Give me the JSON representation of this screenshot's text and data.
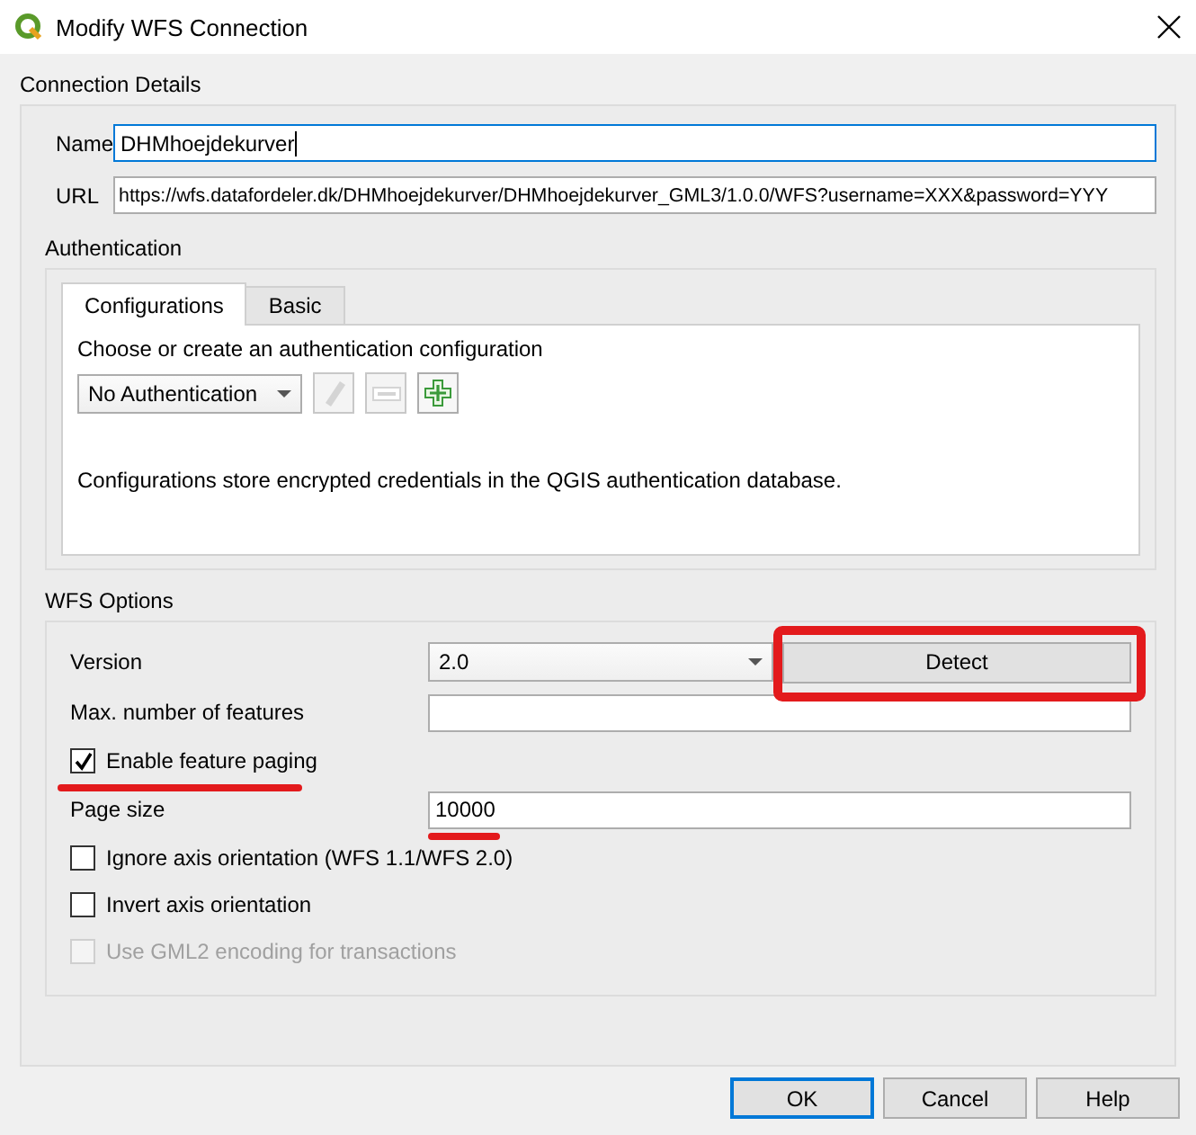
{
  "window": {
    "title": "Modify WFS Connection"
  },
  "connection_details": {
    "title": "Connection Details",
    "name": {
      "label": "Name",
      "value": "DHMhoejdekurver",
      "focused": true
    },
    "url": {
      "label": "URL",
      "value": "https://wfs.datafordeler.dk/DHMhoejdekurver/DHMhoejdekurver_GML3/1.0.0/WFS?username=XXX&password=YYY",
      "focused": false
    }
  },
  "authentication": {
    "title": "Authentication",
    "tabs": [
      {
        "label": "Configurations",
        "selected": true
      },
      {
        "label": "Basic",
        "selected": false
      }
    ],
    "prompt": "Choose or create an authentication configuration",
    "config_select": {
      "value": "No Authentication"
    },
    "tool_buttons": [
      {
        "kind": "edit",
        "disabled": true
      },
      {
        "kind": "remove",
        "disabled": true
      },
      {
        "kind": "add",
        "disabled": false
      }
    ],
    "note": "Configurations store encrypted credentials in the QGIS authentication database."
  },
  "wfs_options": {
    "title": "WFS Options",
    "version": {
      "label": "Version",
      "value": "2.0"
    },
    "detect_button": {
      "label": "Detect",
      "annotated": true
    },
    "max_features": {
      "label": "Max. number of features"
    },
    "paging": {
      "label": "Enable feature paging",
      "checked": true,
      "annotated": true
    },
    "page_size": {
      "label": "Page size",
      "value": "10000",
      "annotated": true
    },
    "options": [
      {
        "label": "Ignore axis orientation (WFS 1.1/WFS 2.0)",
        "checked": false,
        "disabled": false
      },
      {
        "label": "Invert axis orientation",
        "checked": false,
        "disabled": false
      },
      {
        "label": "Use GML2 encoding for transactions",
        "checked": false,
        "disabled": true
      }
    ]
  },
  "buttons": [
    {
      "label": "OK",
      "default": true
    },
    {
      "label": "Cancel",
      "default": false
    },
    {
      "label": "Help",
      "default": false
    }
  ]
}
